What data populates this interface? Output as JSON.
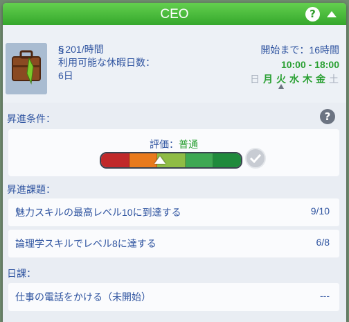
{
  "header": {
    "title": "CEO",
    "help": "?"
  },
  "summary": {
    "salary_symbol": "§",
    "salary": "201/時間",
    "vacation_label": "利用可能な休暇日数：",
    "vacation_days": "6日",
    "starts_label": "開始まで：16時間",
    "hours": "10:00 - 18:00",
    "days": [
      {
        "label": "日",
        "work": false
      },
      {
        "label": "月",
        "work": true
      },
      {
        "label": "火",
        "work": true
      },
      {
        "label": "水",
        "work": true
      },
      {
        "label": "木",
        "work": true
      },
      {
        "label": "金",
        "work": true
      },
      {
        "label": "土",
        "work": false
      }
    ]
  },
  "promotion": {
    "label": "昇進条件：",
    "help": "?",
    "performance_label": "評価：",
    "performance_value": "普通",
    "performance_level": 0.5,
    "meter_colors": [
      "#c0292a",
      "#e87a1c",
      "#8fbc45",
      "#3ea853",
      "#1f8a3c"
    ]
  },
  "tasks": {
    "label": "昇進課題：",
    "items": [
      {
        "text": "魅力スキルの最高レベル10に到達する",
        "value": "9/10"
      },
      {
        "text": "論理学スキルでレベル8に達する",
        "value": "6/8"
      }
    ]
  },
  "daily": {
    "label": "日課：",
    "items": [
      {
        "text": "仕事の電話をかける（未開始）",
        "value": "---"
      }
    ]
  }
}
